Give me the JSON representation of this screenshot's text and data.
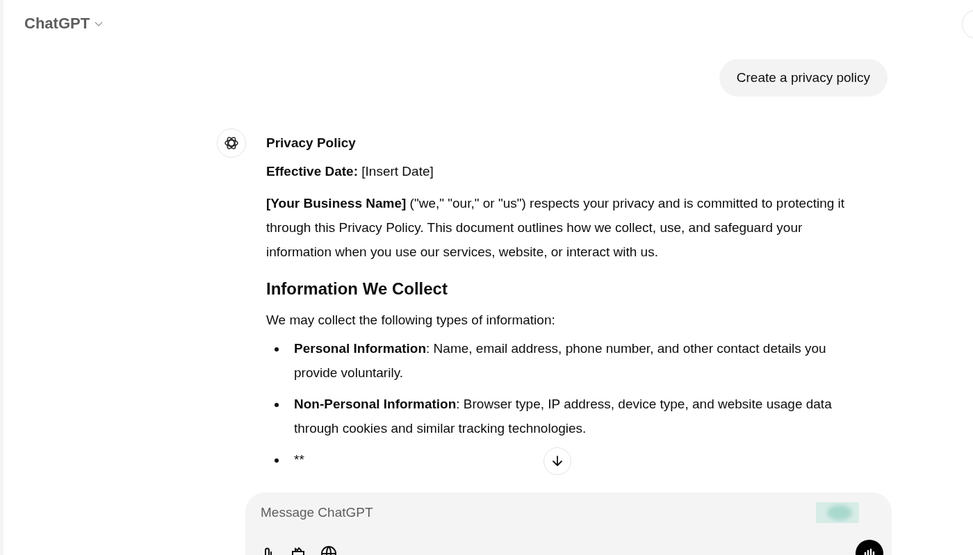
{
  "header": {
    "title": "ChatGPT"
  },
  "user_message": "Create a privacy policy",
  "response": {
    "blocks": [
      {
        "kind": "title",
        "text": "Privacy Policy"
      },
      {
        "kind": "paragraph",
        "text": "**Effective Date:** [Insert Date]"
      },
      {
        "kind": "paragraph",
        "text": "**[Your Business Name]** (\"we,\" \"our,\" or \"us\") respects your privacy and is committed to protecting it through this Privacy Policy. This document outlines how we collect, use, and safeguard your information when you use our services, website, or interact with us."
      },
      {
        "kind": "heading",
        "text": "Information We Collect"
      },
      {
        "kind": "paragraph",
        "text": "We may collect the following types of information:"
      },
      {
        "kind": "bullets",
        "items": [
          "**Personal Information**: Name, email address, phone number, and other contact details you provide voluntarily.",
          "**Non-Personal Information**: Browser type, IP address, device type, and website usage data through cookies and similar tracking technologies.",
          "**"
        ]
      }
    ]
  },
  "composer": {
    "placeholder": "Message ChatGPT"
  }
}
